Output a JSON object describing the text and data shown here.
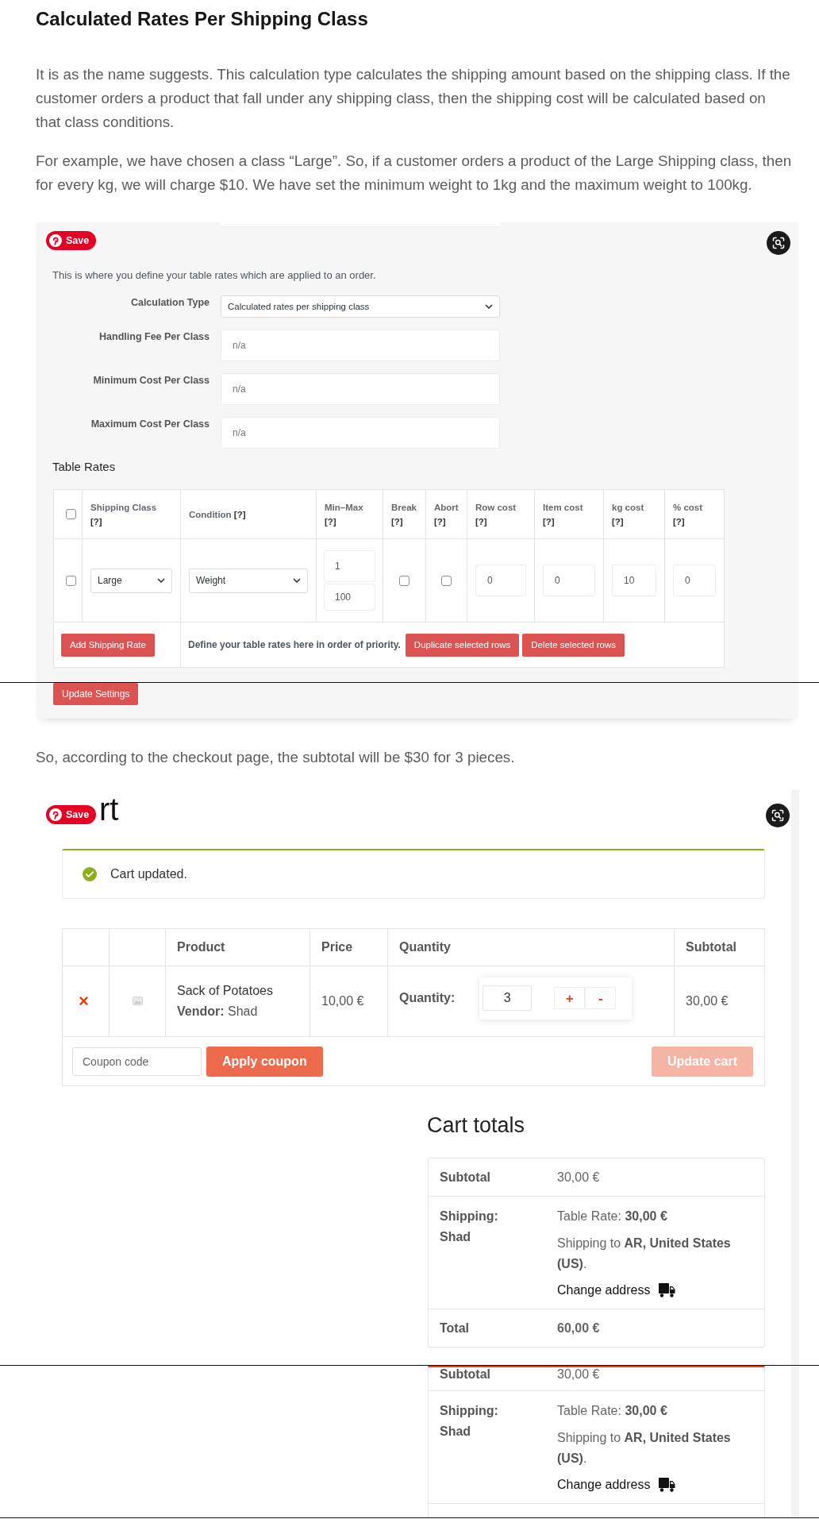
{
  "article": {
    "title": "Calculated Rates Per Shipping Class",
    "paragraphs": [
      "It is as the name suggests. This calculation type calculates the shipping amount based on the shipping class. If the customer orders a product that fall under any shipping class, then the shipping cost will be calculated based on that class conditions.",
      "For example, we have chosen a class “Large”. So, if a customer orders a product of the Large Shipping class, then for every kg, we will charge $10. We have set the minimum weight to 1kg and the maximum weight to 100kg."
    ]
  },
  "settings_screenshot": {
    "save_button": "Save",
    "description": "This is where you define your table rates which are applied to an order.",
    "fields": [
      {
        "kind": "select",
        "label": "Calculation Type",
        "value": "Calculated rates per shipping class"
      },
      {
        "kind": "input",
        "label": "Handling Fee Per Class",
        "placeholder": "n/a"
      },
      {
        "kind": "input",
        "label": "Minimum Cost Per Class",
        "placeholder": "n/a"
      },
      {
        "kind": "input",
        "label": "Maximum Cost Per Class",
        "placeholder": "n/a"
      }
    ],
    "table_title": "Table Rates",
    "table": {
      "select_all": {
        "checked": false
      },
      "columns": [
        {
          "label": "Shipping Class",
          "help": "[?]"
        },
        {
          "label": "Condition",
          "help": "[?]"
        },
        {
          "label": "Min–Max",
          "help": "[?]"
        },
        {
          "label": "Break",
          "help": "[?]"
        },
        {
          "label": "Abort",
          "help": "[?]"
        },
        {
          "label": "Row cost",
          "help": "[?]"
        },
        {
          "label": "Item cost",
          "help": "[?]"
        },
        {
          "label": "kg cost",
          "help": "[?]"
        },
        {
          "label": "% cost",
          "help": "[?]"
        }
      ],
      "rows": [
        {
          "checked": false,
          "cells": [
            {
              "kind": "select",
              "value": "Large"
            },
            {
              "kind": "select",
              "value": "Weight"
            },
            {
              "kind": "range",
              "min": "1",
              "max": "100"
            },
            {
              "kind": "checkbox",
              "checked": false
            },
            {
              "kind": "checkbox",
              "checked": false
            },
            {
              "kind": "input",
              "value": "0"
            },
            {
              "kind": "input",
              "value": "0"
            },
            {
              "kind": "input",
              "value": "10"
            },
            {
              "kind": "input",
              "value": "0"
            }
          ]
        }
      ],
      "add_button": "Add Shipping Rate",
      "note": "Define your table rates here in order of priority.",
      "actions": [
        "Duplicate selected rows",
        "Delete selected rows"
      ]
    },
    "update_button": "Update Settings"
  },
  "cart_intro": "So, according to the checkout page, the subtotal will be $30 for 3 pieces.",
  "cart_screenshot": {
    "heading": "rt",
    "save_button": "Save",
    "notice": "Cart updated.",
    "columns": [
      "Product",
      "Price",
      "Quantity",
      "Subtotal"
    ],
    "items": [
      {
        "remove": "×",
        "product": "Sack of Potatoes",
        "vendor": "**Vendor:** Shad",
        "price": "10,00 €",
        "quantity_label": "Quantity:",
        "quantity": "3",
        "increase": "+",
        "decrease": "-",
        "subtotal": "30,00 €"
      }
    ],
    "coupon": {
      "placeholder": "Coupon code",
      "button": "Apply coupon"
    },
    "update_cart": {
      "label": "Update cart",
      "disabled": true
    },
    "totals": {
      "title": "Cart totals",
      "rows": [
        {
          "kind": "amount",
          "label": "Subtotal",
          "value": "30,00 €"
        },
        {
          "kind": "shipping",
          "label": "Shipping:",
          "package": "Shad",
          "rate": "Table Rate: **30,00 €**",
          "destination": "Shipping to **AR, United States (US)**.",
          "link": "Change address"
        },
        {
          "kind": "total",
          "label": "Total",
          "value": "60,00 €"
        }
      ]
    }
  },
  "cart_totals_repeat": {
    "rows": [
      {
        "kind": "amount",
        "label": "Subtotal",
        "value": "30,00 €"
      },
      {
        "kind": "shipping",
        "label": "Shipping:",
        "package": "Shad",
        "rate": "Table Rate: **30,00 €**",
        "destination": "Shipping to **AR, United States (US)**.",
        "link": "Change address"
      }
    ]
  }
}
